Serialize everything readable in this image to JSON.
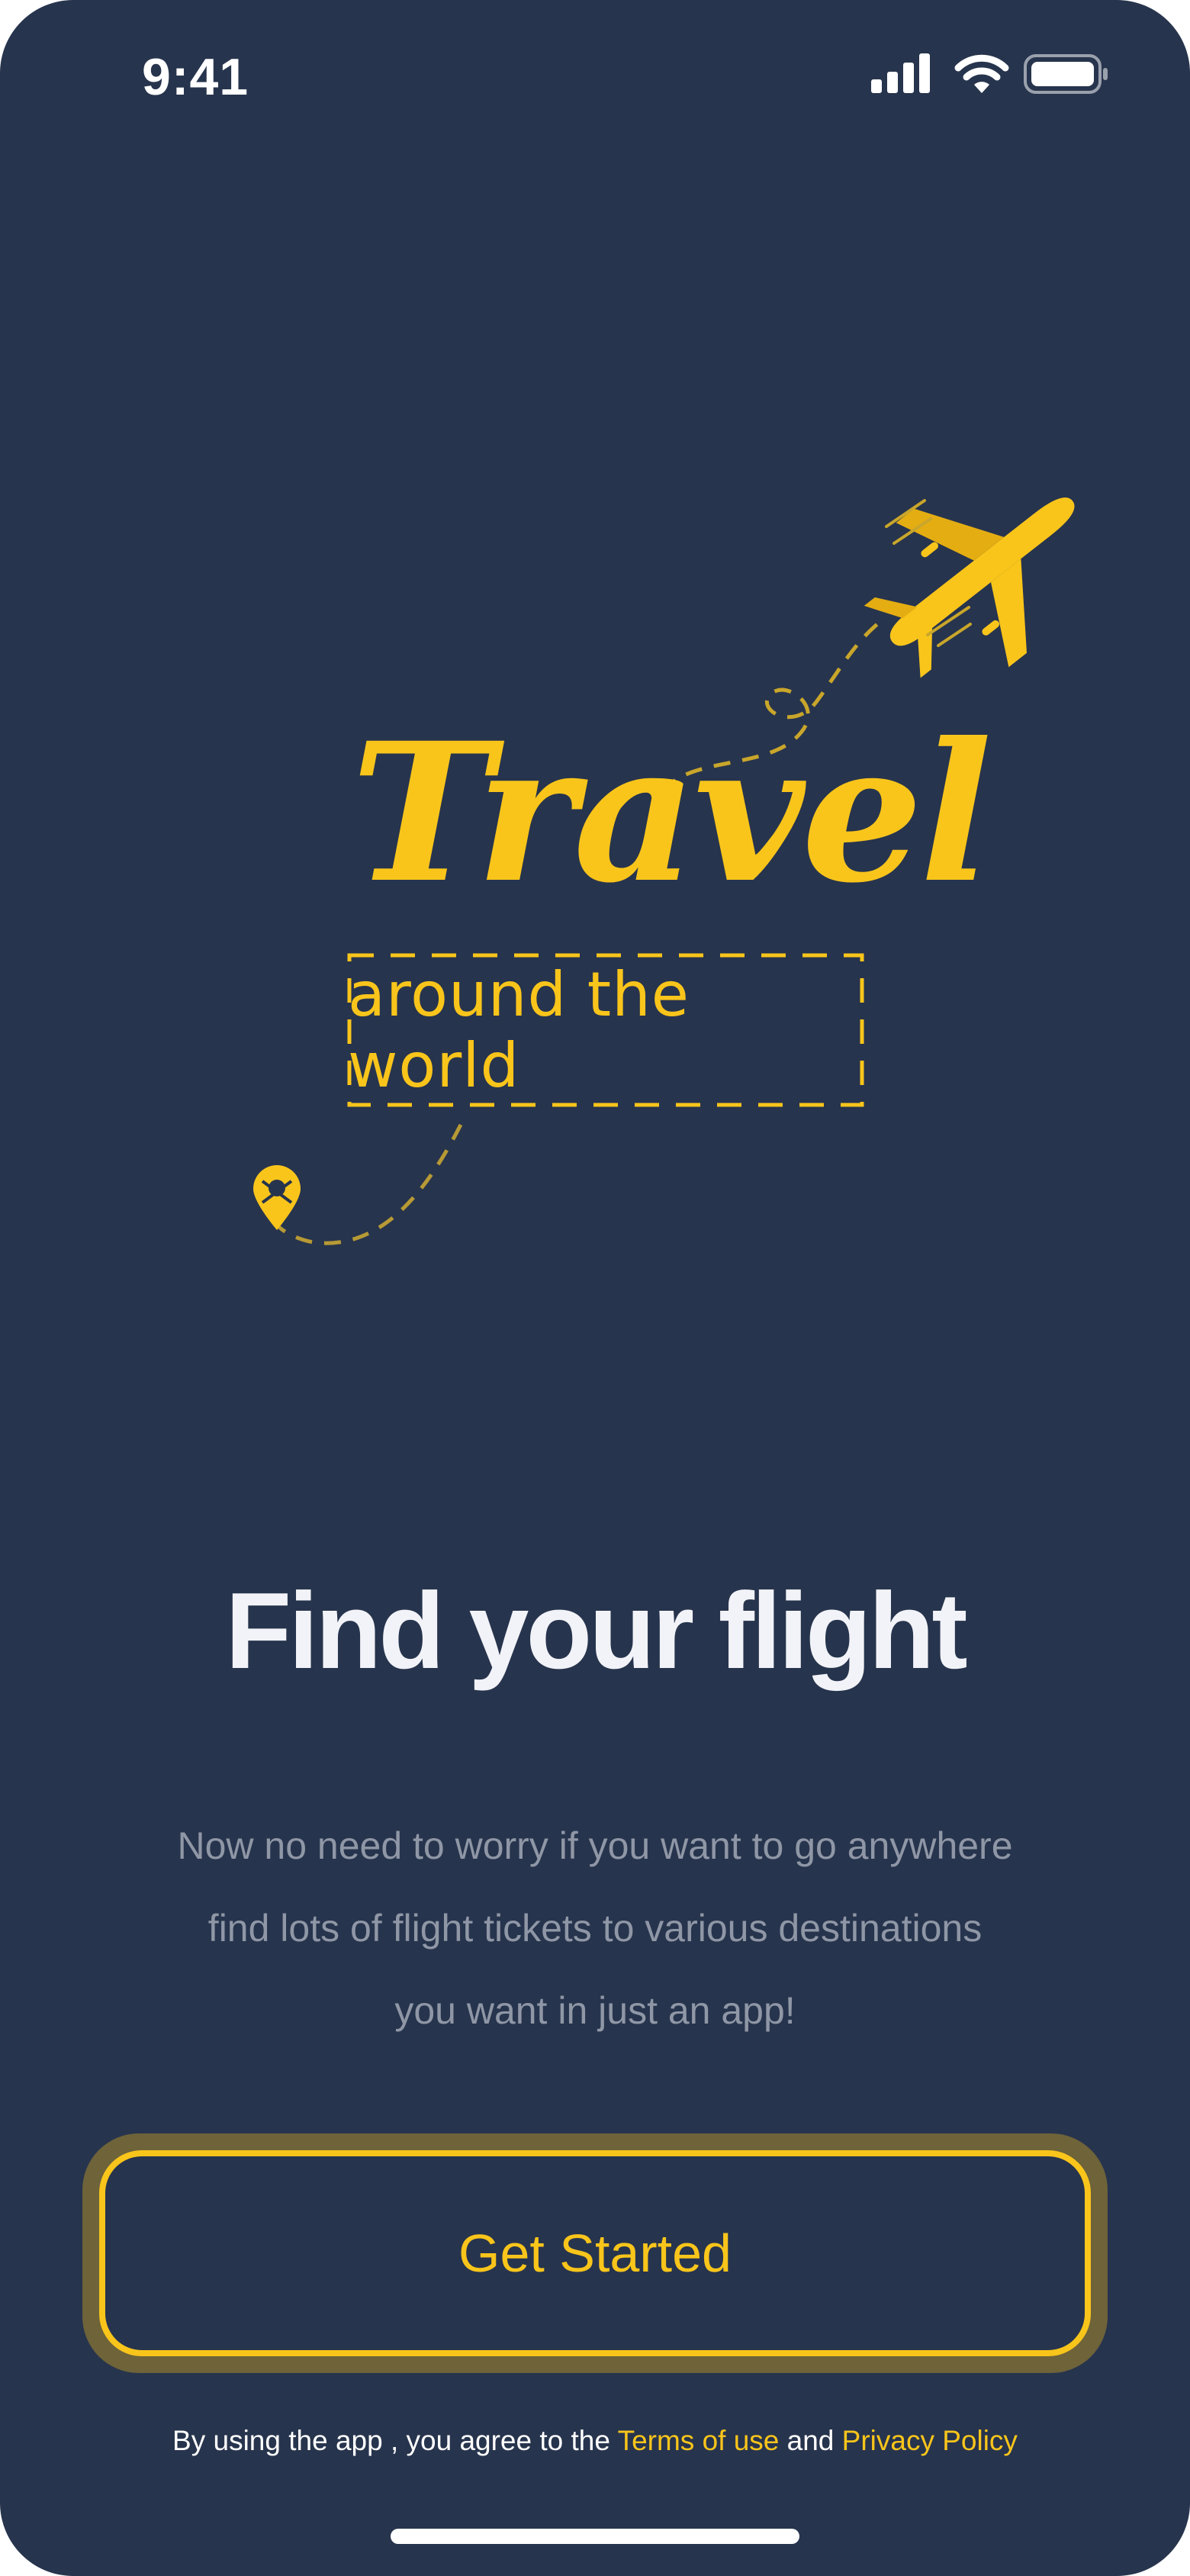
{
  "status_bar": {
    "time": "9:41",
    "icons": [
      "cellular-signal-icon",
      "wifi-icon",
      "battery-icon"
    ]
  },
  "illustration": {
    "logo_text": "Travel",
    "tagline": "around the world",
    "icons": [
      "airplane-icon",
      "location-pin-icon"
    ]
  },
  "onboarding": {
    "title": "Find your flight",
    "description_lines": [
      "Now no need to worry if you want to go anywhere",
      "find lots of flight tickets to various destinations",
      "you want in just an app!"
    ],
    "cta_label": "Get Started"
  },
  "legal": {
    "prefix": "By using the app , you agree to the ",
    "terms_label": "Terms of use",
    "joiner": " and ",
    "privacy_label": "Privacy Policy"
  },
  "colors": {
    "background": "#27344d",
    "accent": "#f9c51b",
    "title": "#f2f3f8",
    "muted_text": "#8f97a6"
  }
}
